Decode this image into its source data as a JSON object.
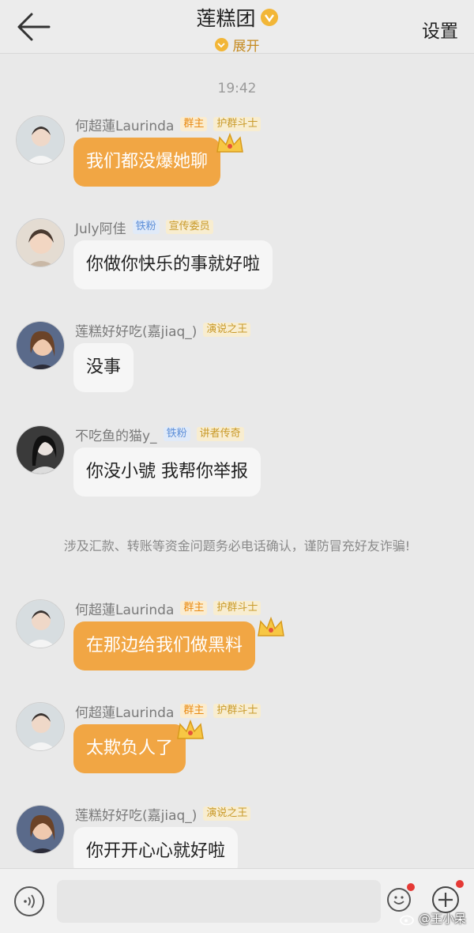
{
  "header": {
    "title": "莲糕团",
    "expand_label": "展开",
    "settings_label": "设置"
  },
  "timestamp": "19:42",
  "messages": [
    {
      "name": "何超蓮Laurinda",
      "tags": [
        "群主",
        "护群斗士"
      ],
      "text": "我们都没爆她聊",
      "style": "orange",
      "crown": true
    },
    {
      "name": "July阿佳",
      "tags": [
        "铁粉",
        "宣传委员"
      ],
      "text": "你做你快乐的事就好啦",
      "style": "gray",
      "crown": false
    },
    {
      "name": "莲糕好好吃(嘉jiaq_)",
      "tags": [
        "演说之王"
      ],
      "text": "没事",
      "style": "gray",
      "crown": false
    },
    {
      "name": "不吃鱼的猫y_",
      "tags": [
        "铁粉",
        "讲者传奇"
      ],
      "text": "你没小號 我帮你举报",
      "style": "gray",
      "crown": false
    },
    {
      "name": "何超蓮Laurinda",
      "tags": [
        "群主",
        "护群斗士"
      ],
      "text": "在那边给我们做黑料",
      "style": "orange",
      "crown": true
    },
    {
      "name": "何超蓮Laurinda",
      "tags": [
        "群主",
        "护群斗士"
      ],
      "text": "太欺负人了",
      "style": "orange",
      "crown": true
    },
    {
      "name": "莲糕好好吃(嘉jiaq_)",
      "tags": [
        "演说之王"
      ],
      "text": "你开开心心就好啦",
      "style": "gray",
      "crown": false
    }
  ],
  "notice": "涉及汇款、转账等资金问题务必电话确认，谨防冒充好友诈骗!",
  "input": {
    "placeholder": ""
  },
  "watermark": "@王小呆",
  "colors": {
    "accent": "#f1a644",
    "badge": "#f2b637",
    "background": "#e9e9e9"
  },
  "icons": [
    "back-arrow-icon",
    "verified-badge-icon",
    "voice-icon",
    "emoji-icon",
    "plus-icon",
    "crown-icon",
    "weibo-icon"
  ]
}
